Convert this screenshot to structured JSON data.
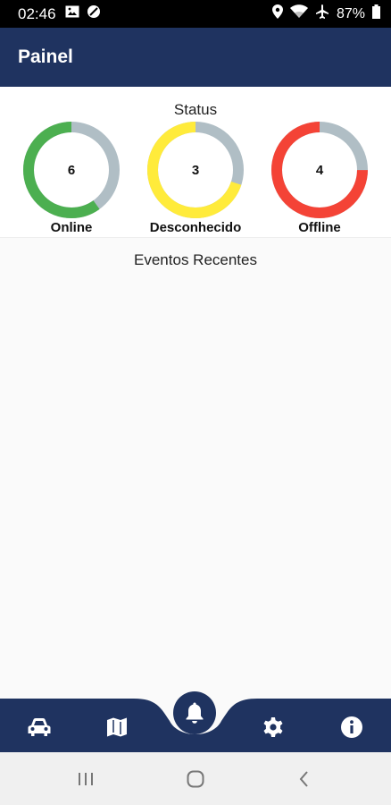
{
  "status_bar": {
    "time": "02:46",
    "battery": "87%",
    "left_icons": [
      "image-icon",
      "no-entry-icon"
    ],
    "right_icons": [
      "location-icon",
      "wifi-icon",
      "airplane-icon",
      "battery-icon"
    ]
  },
  "app_bar": {
    "title": "Painel"
  },
  "status": {
    "title": "Status",
    "items": [
      {
        "label": "Online",
        "count": "6",
        "fraction": 0.6,
        "color": "#4caf50"
      },
      {
        "label": "Desconhecido",
        "count": "3",
        "fraction": 0.7,
        "color": "#ffeb3b"
      },
      {
        "label": "Offline",
        "count": "4",
        "fraction": 0.75,
        "color": "#f44336"
      }
    ],
    "track_color": "#b0bec5"
  },
  "events": {
    "title": "Eventos Recentes"
  },
  "bottom_nav": {
    "items": [
      "car-icon",
      "map-icon",
      "bell-icon",
      "gear-icon",
      "info-icon"
    ],
    "active": "bell-icon",
    "color": "#1f3360"
  },
  "system_nav": [
    "recents-icon",
    "home-icon",
    "back-icon"
  ]
}
